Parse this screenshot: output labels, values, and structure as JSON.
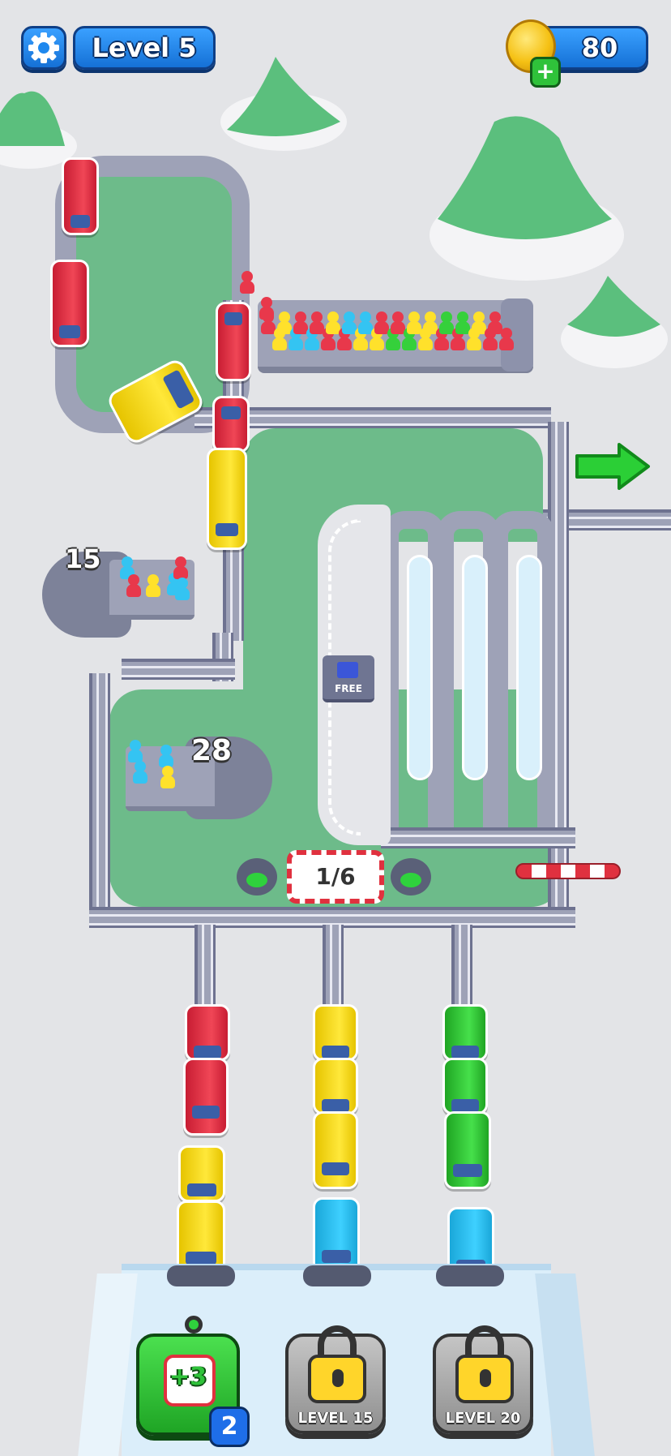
{
  "hud": {
    "level_label": "Level 5",
    "coins": "80",
    "add_coins_symbol": "+",
    "settings_icon": "gear-icon"
  },
  "board": {
    "waiting_count_left": "15",
    "waiting_count_bottom": "28",
    "progress": "1/6",
    "free_label": "FREE",
    "exit_arrow_icon": "green-arrow-right-icon"
  },
  "powerups": {
    "boost_label": "+3",
    "boost_count": "2",
    "lock1_label": "LEVEL 15",
    "lock2_label": "LEVEL 20"
  },
  "colors": {
    "red": "#e8384b",
    "yellow": "#ffe12b",
    "green": "#35d03b",
    "cyan": "#34c4f2",
    "grass": "#6dbb8a",
    "track": "#9ea2b7",
    "hud_blue": "#1e88ee"
  }
}
